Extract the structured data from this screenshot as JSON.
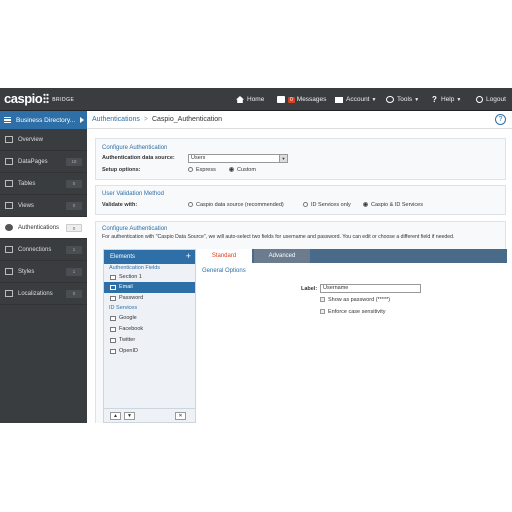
{
  "topbar": {
    "logo": "caspio",
    "logo_sub": "BRIDGE",
    "nav": [
      {
        "label": "Home",
        "icon": "home-icon"
      },
      {
        "label": "Messages",
        "icon": "mail-icon",
        "badge": "0"
      },
      {
        "label": "Account",
        "icon": "account-icon"
      },
      {
        "label": "Tools",
        "icon": "tools-icon"
      },
      {
        "label": "Help",
        "icon": "help-icon"
      },
      {
        "label": "Logout",
        "icon": "power-icon"
      }
    ]
  },
  "sidebar": {
    "app_name": "Business Directory...",
    "items": [
      {
        "label": "Overview",
        "count": ""
      },
      {
        "label": "DataPages",
        "count": "18"
      },
      {
        "label": "Tables",
        "count": "0"
      },
      {
        "label": "Views",
        "count": "0"
      },
      {
        "label": "Authentications",
        "count": "0",
        "active": true
      },
      {
        "label": "Connections",
        "count": "1"
      },
      {
        "label": "Styles",
        "count": "1"
      },
      {
        "label": "Localizations",
        "count": "0"
      }
    ]
  },
  "breadcrumb": {
    "parent": "Authentications",
    "separator": ">",
    "current": "Caspio_Authentication"
  },
  "configure": {
    "title": "Configure Authentication",
    "source_label": "Authentication data source:",
    "source_value": "Users",
    "setup_label": "Setup options:",
    "setup_options": [
      "Express",
      "Custom"
    ],
    "setup_selected": "Custom"
  },
  "validation": {
    "title": "User Validation Method",
    "validate_label": "Validate with:",
    "options": [
      "Caspio data source (recommended)",
      "ID Services only",
      "Caspio & ID Services"
    ],
    "selected": "Caspio & ID Services"
  },
  "fields_section": {
    "title": "Configure Authentication",
    "description": "For authentication with \"Caspio Data Source\", we will auto-select two fields for username and password. You can edit or choose a different field if needed."
  },
  "elements": {
    "header": "Elements",
    "auth_fields_title": "Authentication Fields",
    "section": "Section 1",
    "auth_fields": [
      "Email",
      "Password"
    ],
    "selected": "Email",
    "id_services_title": "ID Services",
    "id_services": [
      "Google",
      "Facebook",
      "Twitter",
      "OpenID"
    ]
  },
  "tabs": [
    "Standard",
    "Advanced"
  ],
  "general": {
    "title": "General Options",
    "label_label": "Label:",
    "label_value": "Username",
    "show_password": "Show as password (*****)",
    "enforce_case": "Enforce case sensitivity"
  },
  "colors": {
    "accent": "#2e6fa7",
    "topbar": "#3a3d40",
    "tab_active_text": "#d9401f"
  }
}
